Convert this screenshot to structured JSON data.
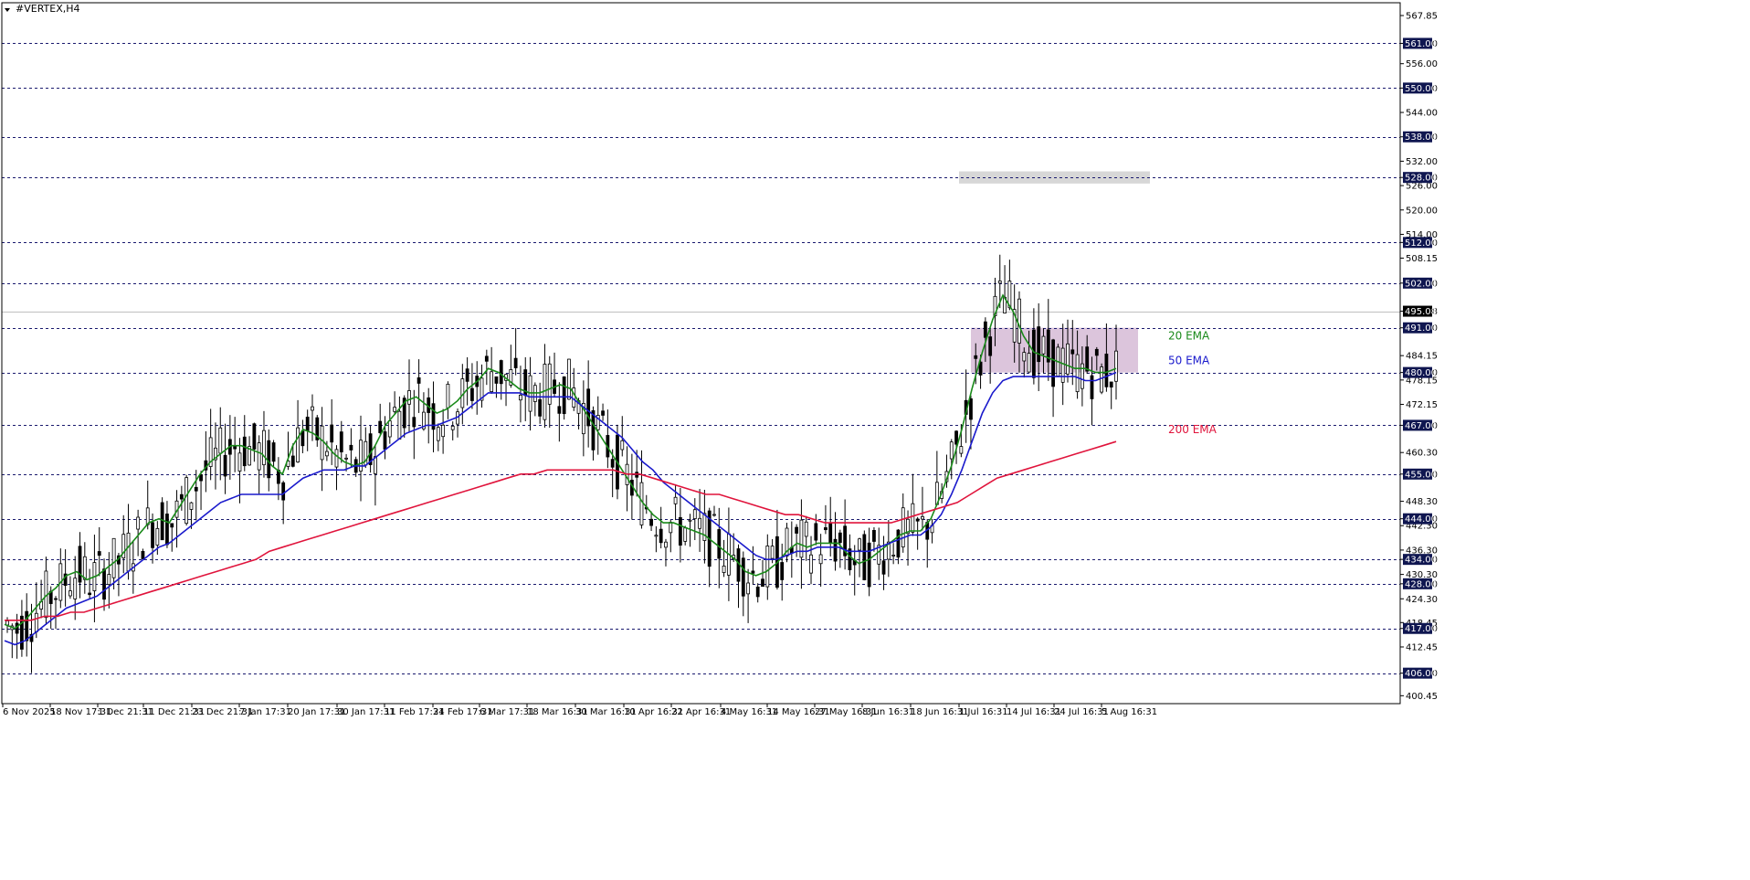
{
  "window": {
    "symbol_title": "#VERTEX,H4"
  },
  "chart_data": {
    "type": "candlestick",
    "symbol": "#VERTEX",
    "timeframe": "H4",
    "ylim": [
      398.5,
      571
    ],
    "current_price": 495.08,
    "y_ticks": [
      "567.85",
      "561.00",
      "556.00",
      "550.00",
      "544.00",
      "538.00",
      "532.00",
      "528.00",
      "526.00",
      "520.00",
      "514.00",
      "512.00",
      "508.15",
      "502.00",
      "495.08",
      "491.00",
      "484.15",
      "480.00",
      "478.15",
      "472.15",
      "467.00",
      "460.30",
      "455.00",
      "448.30",
      "444.00",
      "442.30",
      "436.30",
      "434.00",
      "430.30",
      "428.00",
      "424.30",
      "418.45",
      "417.00",
      "412.45",
      "406.00",
      "400.45"
    ],
    "x_ticks": [
      "6 Nov 2025",
      "18 Nov 17:31",
      "1 Dec 21:31",
      "11 Dec 21:31",
      "23 Dec 21:31",
      "7 Jan 17:31",
      "20 Jan 17:31",
      "30 Jan 17:31",
      "11 Feb 17:31",
      "24 Feb 17:31",
      "6 Mar 17:31",
      "18 Mar 16:31",
      "30 Mar 16:31",
      "10 Apr 16:31",
      "22 Apr 16:31",
      "4 May 16:31",
      "14 May 16:31",
      "27 May 16:31",
      "8 Jun 16:31",
      "18 Jun 16:31",
      "1 Jul 16:31",
      "14 Jul 16:31",
      "24 Jul 16:31",
      "5 Aug 16:31"
    ],
    "levels": [
      561.0,
      550.0,
      538.0,
      528.0,
      512.0,
      502.0,
      491.0,
      480.0,
      467.0,
      455.0,
      444.0,
      434.0,
      428.0,
      417.0,
      406.0
    ],
    "level_labels": [
      "561.00",
      "550.00",
      "538.00",
      "528.00",
      "512.00",
      "502.00",
      "491.00",
      "480.00",
      "467.00",
      "455.00",
      "444.00",
      "434.00",
      "428.00",
      "417.00",
      "406.00"
    ],
    "zones": [
      {
        "name": "resistance-zone",
        "y_from": 526.5,
        "y_to": 529.5,
        "color": "#d3d3d3"
      },
      {
        "name": "range-zone",
        "y_from": 480.0,
        "y_to": 491.0,
        "color": "#d8bfd8"
      }
    ],
    "series": [
      {
        "name": "20 EMA",
        "color": "#1a8a1a",
        "values": [
          418,
          417,
          419,
          422,
          425,
          427,
          430,
          431,
          429,
          430,
          432,
          434,
          437,
          440,
          443,
          444,
          443,
          447,
          451,
          455,
          458,
          460,
          462,
          462,
          461,
          460,
          457,
          455,
          462,
          466,
          465,
          463,
          460,
          458,
          457,
          458,
          462,
          467,
          470,
          473,
          474,
          472,
          470,
          471,
          473,
          476,
          478,
          481,
          480,
          478,
          476,
          475,
          475,
          476,
          477,
          476,
          472,
          468,
          464,
          460,
          456,
          452,
          448,
          445,
          443,
          443,
          442,
          441,
          440,
          438,
          436,
          434,
          431,
          430,
          431,
          433,
          436,
          438,
          437,
          438,
          438,
          438,
          435,
          433,
          434,
          436,
          438,
          440,
          441,
          441,
          444,
          450,
          457,
          466,
          476,
          485,
          493,
          499,
          495,
          489,
          485,
          484,
          483,
          482,
          481,
          481,
          480,
          480,
          481
        ]
      },
      {
        "name": "50 EMA",
        "color": "#1a1acc",
        "values": [
          414,
          413,
          414,
          416,
          418,
          420,
          422,
          423,
          424,
          425,
          427,
          429,
          431,
          433,
          435,
          437,
          438,
          440,
          442,
          444,
          446,
          448,
          449,
          450,
          450,
          450,
          450,
          450,
          452,
          454,
          455,
          456,
          456,
          456,
          457,
          457,
          459,
          461,
          463,
          465,
          466,
          467,
          467,
          468,
          469,
          471,
          473,
          475,
          475,
          475,
          475,
          474,
          474,
          474,
          474,
          474,
          472,
          470,
          468,
          466,
          464,
          461,
          458,
          456,
          453,
          451,
          449,
          447,
          445,
          443,
          441,
          439,
          437,
          435,
          434,
          434,
          435,
          436,
          436,
          437,
          437,
          437,
          436,
          436,
          436,
          437,
          438,
          439,
          440,
          440,
          442,
          445,
          450,
          456,
          463,
          470,
          475,
          478,
          479,
          479,
          479,
          479,
          479,
          479,
          479,
          478,
          478,
          479,
          480
        ]
      },
      {
        "name": "200 EMA",
        "color": "#e0143c",
        "values": [
          419,
          419,
          419,
          420,
          420,
          421,
          421,
          422,
          423,
          424,
          425,
          426,
          427,
          428,
          429,
          430,
          431,
          432,
          433,
          434,
          436,
          437,
          438,
          439,
          440,
          441,
          442,
          443,
          444,
          445,
          446,
          447,
          448,
          449,
          450,
          451,
          452,
          453,
          454,
          455,
          455,
          456,
          456,
          456,
          456,
          456,
          456,
          455,
          455,
          454,
          453,
          452,
          451,
          450,
          450,
          449,
          448,
          447,
          446,
          445,
          445,
          444,
          443,
          443,
          443,
          443,
          443,
          443,
          444,
          445,
          446,
          447,
          448,
          450,
          452,
          454,
          455,
          456,
          457,
          458,
          459,
          460,
          461,
          462,
          463
        ]
      }
    ],
    "legend": [
      {
        "label": "20 EMA",
        "color": "#1a8a1a"
      },
      {
        "label": "50 EMA",
        "color": "#1a1acc"
      },
      {
        "label": "200 EMA",
        "color": "#e0143c"
      }
    ],
    "colors": {
      "candle": "#000000",
      "level_line": "#1a1a6e",
      "level_badge": "#0f1650",
      "current_badge": "#000000",
      "current_line": "#c0c0c0"
    }
  }
}
